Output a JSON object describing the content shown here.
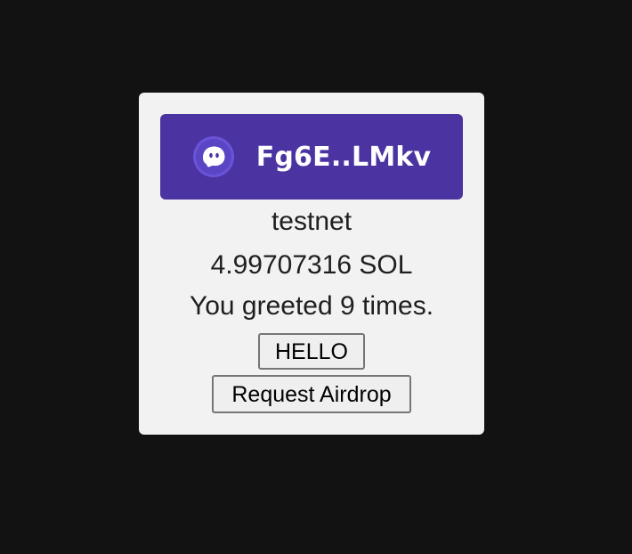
{
  "wallet": {
    "address_short": "Fg6E..LMkv",
    "icon": "phantom-ghost-icon",
    "button_color": "#4b33a1"
  },
  "network": "testnet",
  "balance": "4.99707316 SOL",
  "greeting": "You greeted 9 times.",
  "buttons": {
    "hello": "HELLO",
    "airdrop": "Request Airdrop"
  },
  "colors": {
    "background": "#121212",
    "card": "#f2f2f2"
  }
}
